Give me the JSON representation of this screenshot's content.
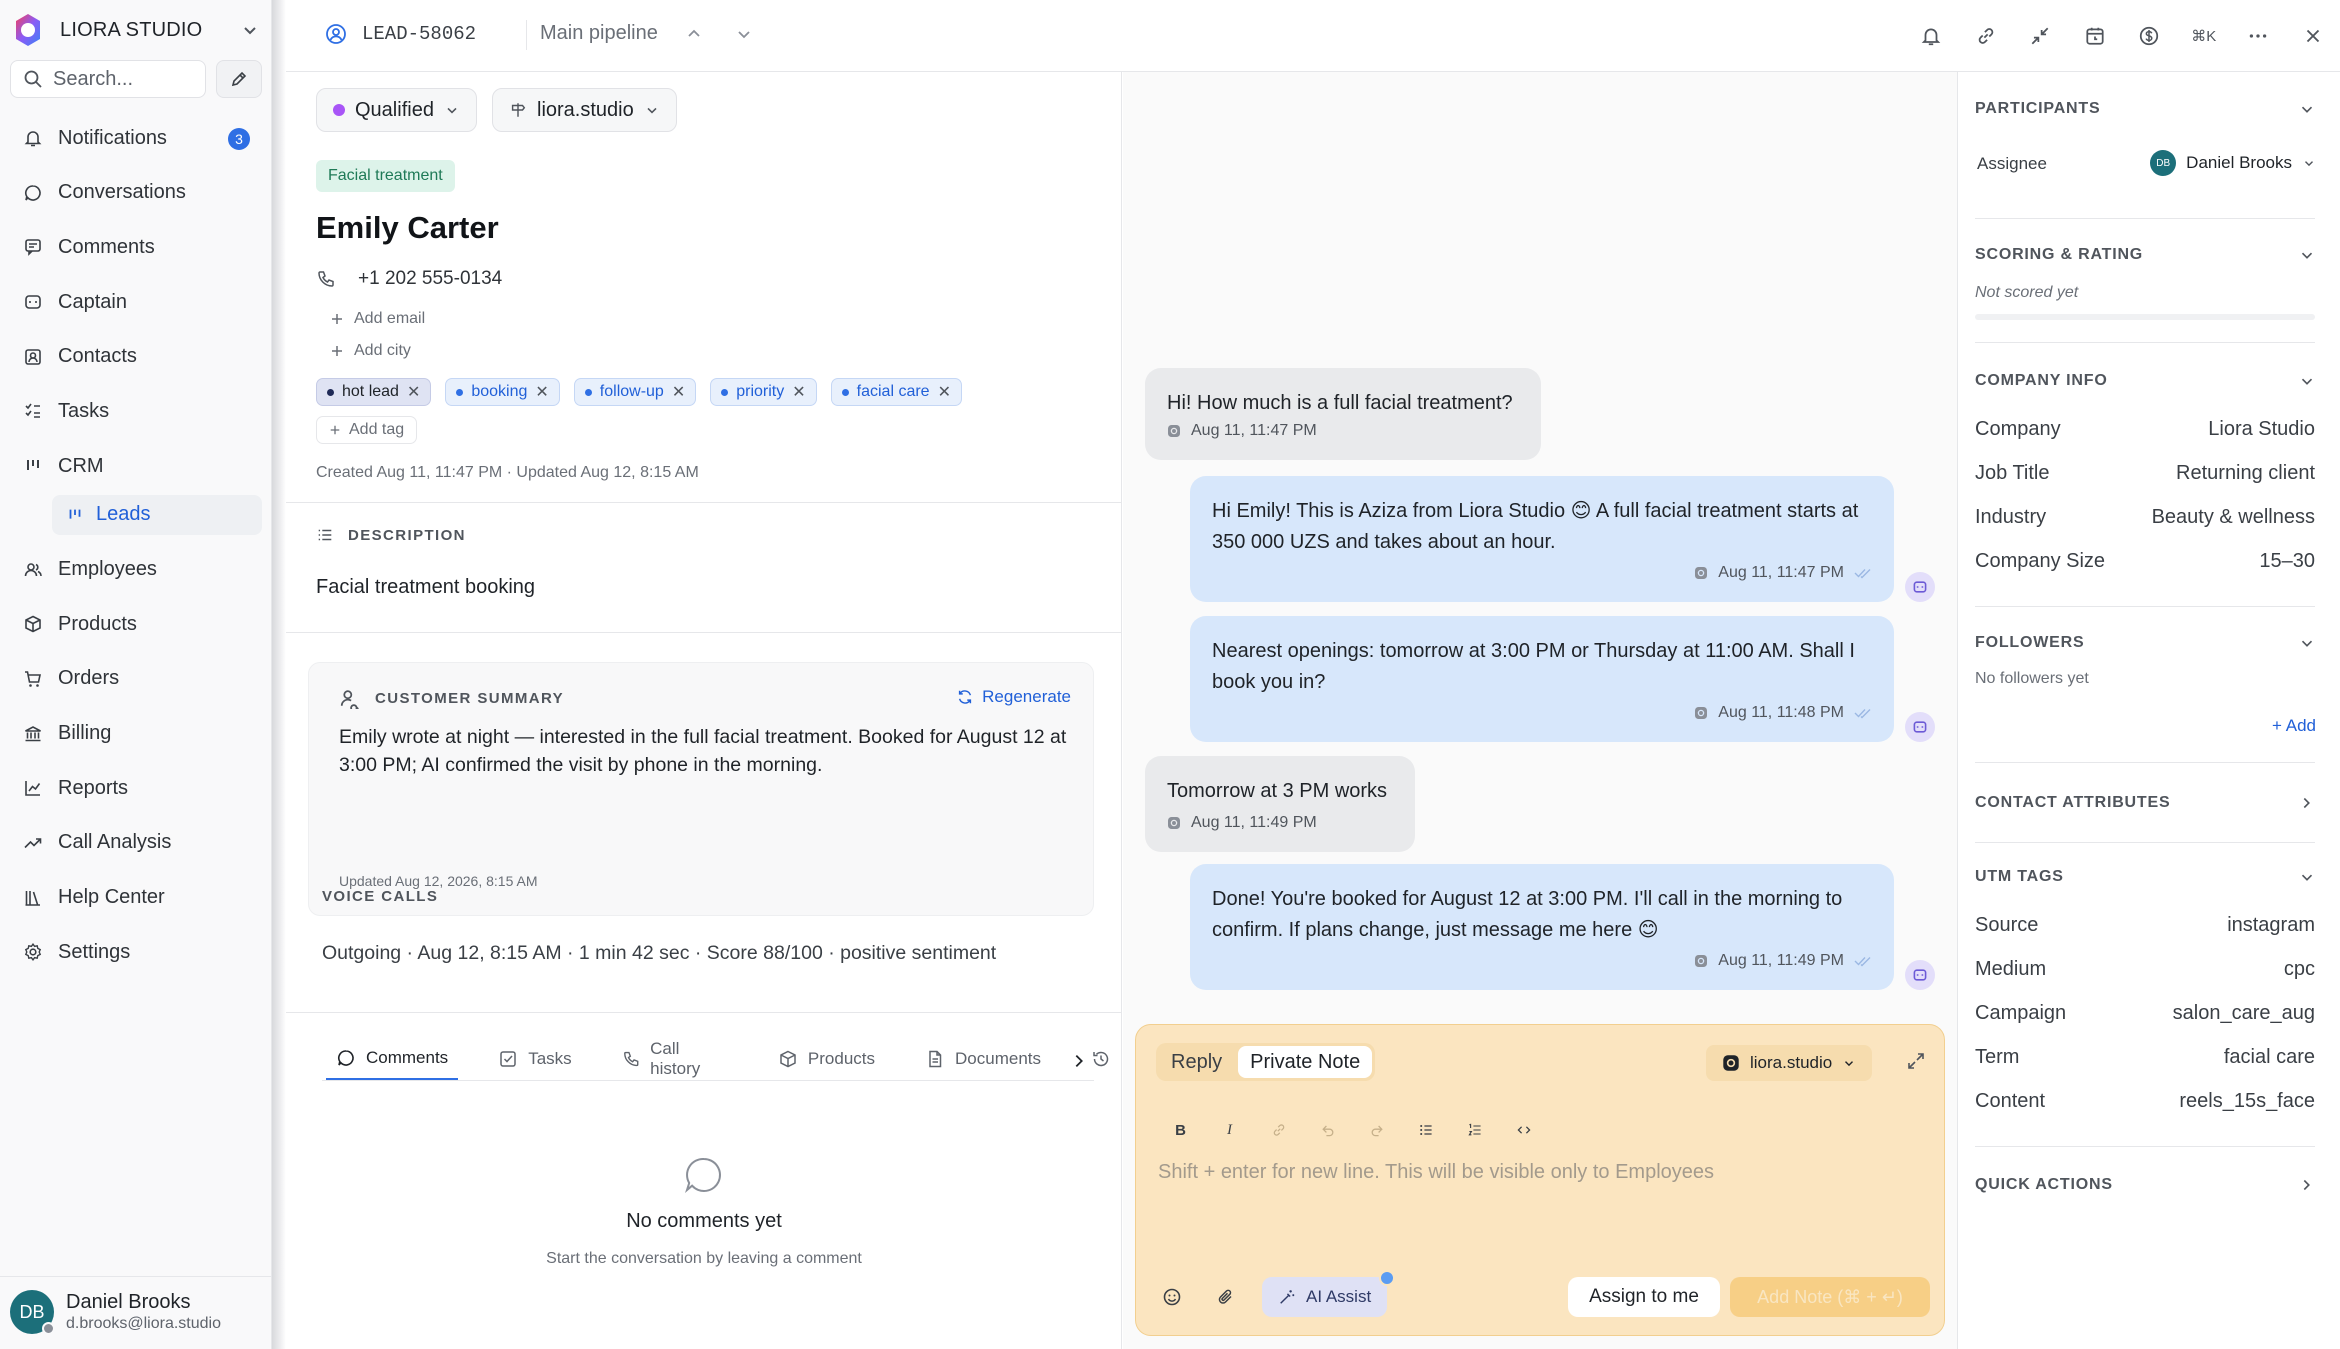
{
  "sidebar": {
    "brand": "LIORA STUDIO",
    "search_placeholder": "Search...",
    "nav": [
      {
        "label": "Notifications",
        "icon": "bell-icon",
        "badge": "3"
      },
      {
        "label": "Conversations",
        "icon": "chat-bubble-icon"
      },
      {
        "label": "Comments",
        "icon": "comment-icon"
      },
      {
        "label": "Captain",
        "icon": "bot-icon"
      },
      {
        "label": "Contacts",
        "icon": "contact-card-icon"
      },
      {
        "label": "Tasks",
        "icon": "checklist-icon"
      },
      {
        "label": "CRM",
        "icon": "kanban-icon"
      }
    ],
    "sub_nav": {
      "label": "Leads",
      "icon": "kanban-icon"
    },
    "nav_bottom": [
      {
        "label": "Employees",
        "icon": "users-icon"
      },
      {
        "label": "Products",
        "icon": "box-icon"
      },
      {
        "label": "Orders",
        "icon": "cart-icon"
      },
      {
        "label": "Billing",
        "icon": "bank-icon"
      },
      {
        "label": "Reports",
        "icon": "line-chart-icon"
      },
      {
        "label": "Call Analysis",
        "icon": "trend-icon"
      },
      {
        "label": "Help Center",
        "icon": "library-icon"
      },
      {
        "label": "Settings",
        "icon": "gear-icon"
      }
    ],
    "user": {
      "initials": "DB",
      "name": "Daniel Brooks",
      "email": "d.brooks@liora.studio"
    }
  },
  "topbar": {
    "lead_id": "LEAD-58062",
    "pipeline": "Main pipeline",
    "shortcut": "⌘K"
  },
  "lead": {
    "status": "Qualified",
    "source": "liora.studio",
    "service": "Facial treatment",
    "name": "Emily Carter",
    "phone": "+1 202 555-0134",
    "add_email": "Add email",
    "add_city": "Add city",
    "tags": [
      "hot lead",
      "booking",
      "follow-up",
      "priority",
      "facial care"
    ],
    "add_tag": "Add tag",
    "created": "Created Aug 11, 11:47 PM · Updated Aug 12, 8:15 AM",
    "description_title": "DESCRIPTION",
    "description": "Facial treatment booking",
    "summary_title": "CUSTOMER SUMMARY",
    "regenerate": "Regenerate",
    "summary": "Emily wrote at night — interested in the full facial treatment. Booked for August 12 at 3:00 PM; AI confirmed the visit by phone in the morning.",
    "summary_updated": "Updated Aug 12, 2026, 8:15 AM",
    "voice_title": "VOICE CALLS",
    "voice_call": "Outgoing · Aug 12, 8:15 AM · 1 min 42 sec · Score 88/100 · positive sentiment",
    "tabs": [
      "Comments",
      "Tasks",
      "Call history",
      "Products",
      "Documents"
    ],
    "empty_title": "No comments yet",
    "empty_sub": "Start the conversation by leaving a comment"
  },
  "conversation": {
    "messages": [
      {
        "dir": "in",
        "text": "Hi! How much is a full facial treatment?",
        "time": "Aug 11, 11:47 PM"
      },
      {
        "dir": "out",
        "text": "Hi Emily! This is Aziza from Liora Studio 😊 A full facial treatment starts at 350 000 UZS and takes about an hour.",
        "time": "Aug 11, 11:47 PM"
      },
      {
        "dir": "out",
        "text": "Nearest openings: tomorrow at 3:00 PM or Thursday at 11:00 AM. Shall I book you in?",
        "time": "Aug 11, 11:48 PM"
      },
      {
        "dir": "in",
        "text": "Tomorrow at 3 PM works",
        "time": "Aug 11, 11:49 PM"
      },
      {
        "dir": "out",
        "text": "Done! You're booked for August 12 at 3:00 PM. I'll call in the morning to confirm. If plans change, just message me here 😊",
        "time": "Aug 11, 11:49 PM"
      }
    ]
  },
  "composer": {
    "reply": "Reply",
    "private_note": "Private Note",
    "inbox": "liora.studio",
    "placeholder": "Shift + enter for new line. This will be visible only to Employees",
    "ai_assist": "AI Assist",
    "assign": "Assign to me",
    "add_note": "Add Note (⌘ + ↵)"
  },
  "right": {
    "participants": "PARTICIPANTS",
    "assignee_label": "Assignee",
    "assignee_initials": "DB",
    "assignee": "Daniel Brooks",
    "scoring": "SCORING & RATING",
    "not_scored": "Not scored yet",
    "company_info": "COMPANY INFO",
    "company_fields": [
      {
        "k": "Company",
        "v": "Liora Studio"
      },
      {
        "k": "Job Title",
        "v": "Returning client"
      },
      {
        "k": "Industry",
        "v": "Beauty & wellness"
      },
      {
        "k": "Company Size",
        "v": "15–30"
      }
    ],
    "followers": "FOLLOWERS",
    "no_followers": "No followers yet",
    "add": "+ Add",
    "contact_attributes": "CONTACT ATTRIBUTES",
    "utm": "UTM TAGS",
    "utm_fields": [
      {
        "k": "Source",
        "v": "instagram"
      },
      {
        "k": "Medium",
        "v": "cpc"
      },
      {
        "k": "Campaign",
        "v": "salon_care_aug"
      },
      {
        "k": "Term",
        "v": "facial care"
      },
      {
        "k": "Content",
        "v": "reels_15s_face"
      }
    ],
    "quick_actions": "QUICK ACTIONS"
  },
  "colors": {
    "accent": "#2f6fe4",
    "note_bg": "#fbe5c0",
    "out_bubble": "#d7e7fb",
    "in_bubble": "#e9eaec",
    "status_dot": "#a855f7"
  }
}
